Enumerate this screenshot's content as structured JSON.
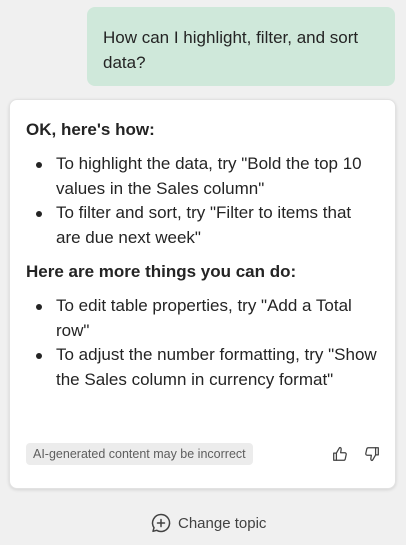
{
  "user_message": "How can I highlight, filter, and sort data?",
  "response": {
    "heading_1": "OK, here's how:",
    "tips_1": [
      "To highlight the data, try \"Bold the top 10 values in the Sales column\"",
      "To filter and sort, try \"Filter to items that are due next week\""
    ],
    "heading_2": "Here are more things you can do:",
    "tips_2": [
      "To edit table properties, try \"Add a Total row\"",
      "To adjust the number formatting, try \"Show the Sales column in currency format\""
    ],
    "disclaimer": "AI-generated content may be incorrect",
    "feedback_icons": [
      "thumbs-up-icon",
      "thumbs-down-icon"
    ]
  },
  "footer": {
    "change_topic_label": "Change topic",
    "change_topic_icon": "chat-add-icon"
  },
  "colors": {
    "user_bubble": "#cfe8da",
    "card_background": "#ffffff",
    "page_background": "#f0f0f0",
    "text": "#242424"
  }
}
